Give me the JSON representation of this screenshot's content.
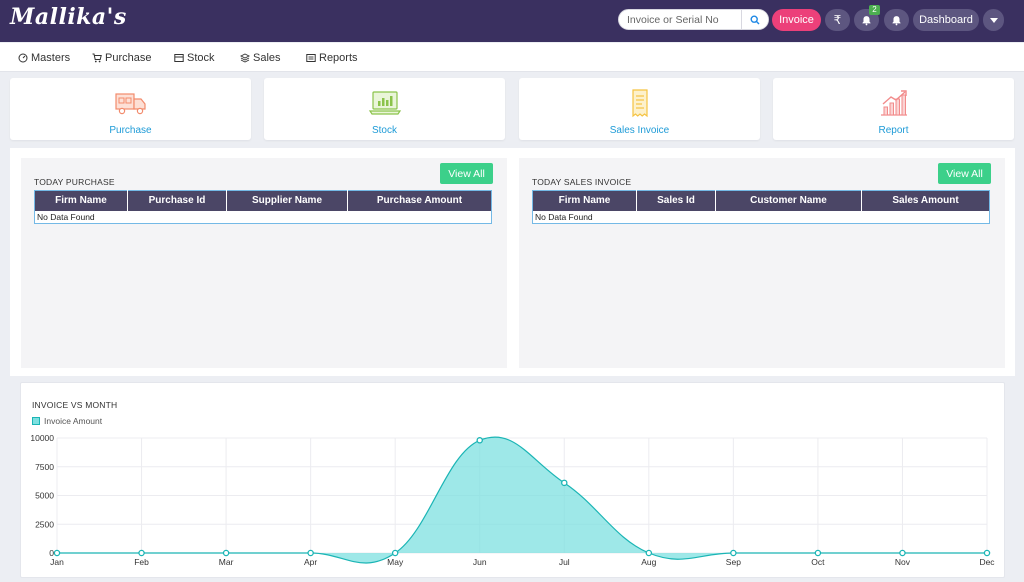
{
  "brand": {
    "name": "Mallika's"
  },
  "search": {
    "placeholder": "Invoice or Serial No"
  },
  "header": {
    "invoice_label": "Invoice",
    "notification_count": "2",
    "dashboard_label": "Dashboard"
  },
  "menu": [
    {
      "label": "Masters",
      "icon": "dashboard-icon"
    },
    {
      "label": "Purchase",
      "icon": "cart-icon"
    },
    {
      "label": "Stock",
      "icon": "box-icon"
    },
    {
      "label": "Sales",
      "icon": "layers-icon"
    },
    {
      "label": "Reports",
      "icon": "report-icon"
    }
  ],
  "tiles": [
    {
      "label": "Purchase",
      "icon": "truck-icon",
      "color": "#f28b6c"
    },
    {
      "label": "Stock",
      "icon": "laptop-chart-icon",
      "color": "#8bc34a"
    },
    {
      "label": "Sales Invoice",
      "icon": "receipt-icon",
      "color": "#f5c342"
    },
    {
      "label": "Report",
      "icon": "growth-chart-icon",
      "color": "#f28b8b"
    }
  ],
  "purchase_panel": {
    "title": "TODAY PURCHASE",
    "view_all": "View All",
    "columns": [
      "Firm Name",
      "Purchase Id",
      "Supplier Name",
      "Purchase Amount"
    ],
    "empty": "No Data Found"
  },
  "sales_panel": {
    "title": "TODAY SALES INVOICE",
    "view_all": "View All",
    "columns": [
      "Firm Name",
      "Sales Id",
      "Customer Name",
      "Sales Amount"
    ],
    "empty": "No Data Found"
  },
  "colors": {
    "topbar": "#3a3060",
    "accent_pink": "#ec407a",
    "view_all_green": "#3cd08a",
    "table_header": "#4b4666",
    "area_fill": "#7ee0e0",
    "area_stroke": "#1bb5b5"
  },
  "chart_data": {
    "type": "area",
    "title": "INVOICE VS MONTH",
    "categories": [
      "Jan",
      "Feb",
      "Mar",
      "Apr",
      "May",
      "Jun",
      "Jul",
      "Aug",
      "Sep",
      "Oct",
      "Nov",
      "Dec"
    ],
    "series": [
      {
        "name": "Invoice Amount",
        "values": [
          0,
          0,
          0,
          0,
          0,
          9800,
          6100,
          0,
          0,
          0,
          0,
          0
        ]
      }
    ],
    "yticks": [
      "0",
      "2500",
      "5000",
      "7500",
      "10000"
    ],
    "ylim": [
      0,
      10000
    ],
    "grid": true,
    "legend": "top-left"
  }
}
